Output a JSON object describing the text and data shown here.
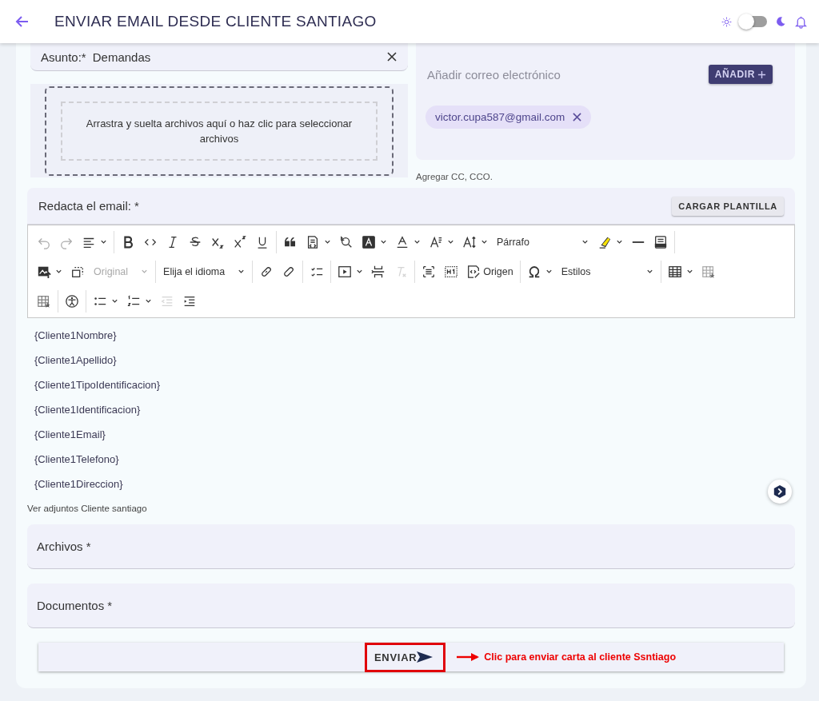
{
  "header": {
    "title": "ENVIAR EMAIL DESDE CLIENTE SANTIAGO",
    "dark_mode": false
  },
  "subject": {
    "label": "Asunto:*",
    "value": "Demandas"
  },
  "dropzone": {
    "text": "Arrastra y suelta archivos aquí o haz clic para seleccionar archivos"
  },
  "recipients": {
    "placeholder": "Añadir correo electrónico",
    "add_button": "AÑADIR",
    "chips": [
      "victor.cupa587@gmail.com"
    ]
  },
  "cc_link": "Agregar CC, CCO.",
  "editor": {
    "label": "Redacta el email: *",
    "template_button": "CARGAR PLANTILLA",
    "toolbar": {
      "selects": [
        {
          "value": "Párrafo",
          "disabled": false
        },
        {
          "value": "Original",
          "disabled": true
        },
        {
          "value": "Elija el idioma",
          "disabled": false
        },
        {
          "value": "Estilos",
          "disabled": false
        }
      ],
      "source_button": "Origen"
    },
    "lines": [
      "{Cliente1Nombre}",
      "{Cliente1Apellido}",
      "{Cliente1TipoIdentificacion}",
      "{Cliente1Identificacion}",
      "{Cliente1Email}",
      "{Cliente1Telefono}",
      "{Cliente1Direccion}"
    ]
  },
  "attachments_link": "Ver adjuntos Cliente santiago",
  "fields": [
    {
      "label": "Archivos *"
    },
    {
      "label": "Documentos *"
    }
  ],
  "send_button": "ENVIAR",
  "annotation": {
    "text": "Clic para enviar carta al cliente Ssntiago"
  }
}
